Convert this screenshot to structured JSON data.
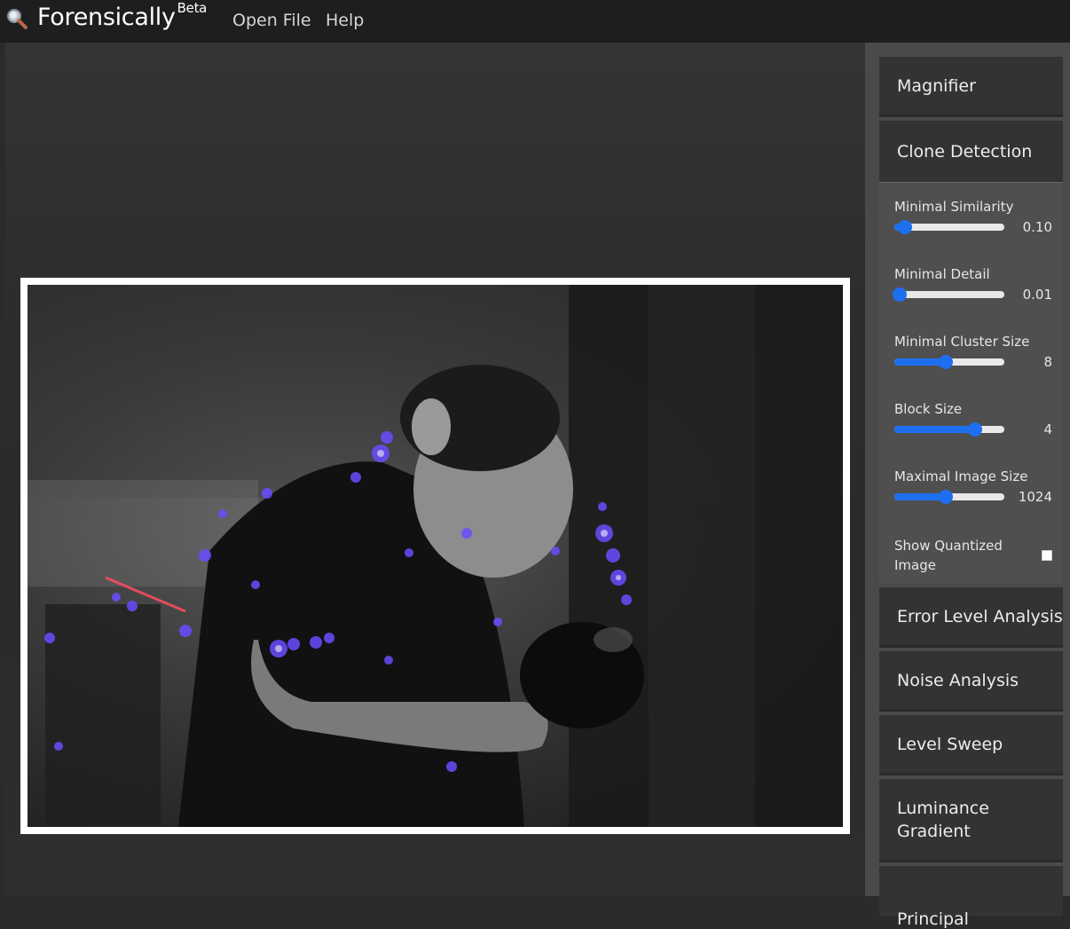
{
  "header": {
    "brand": "Forensically",
    "brand_sup": "Beta",
    "nav": {
      "open_file": "Open File",
      "help": "Help"
    }
  },
  "sidebar": {
    "panels_top": [
      {
        "id": "magnifier",
        "label": "Magnifier"
      },
      {
        "id": "clone",
        "label": "Clone Detection"
      }
    ],
    "clone_controls": [
      {
        "label": "Minimal Similarity",
        "value": "0.10",
        "fraction": 0.1
      },
      {
        "label": "Minimal Detail",
        "value": "0.01",
        "fraction": 0.05
      },
      {
        "label": "Minimal Cluster Size",
        "value": "8",
        "fraction": 0.47
      },
      {
        "label": "Block Size",
        "value": "4",
        "fraction": 0.73
      },
      {
        "label": "Maximal Image Size",
        "value": "1024",
        "fraction": 0.47
      }
    ],
    "show_quantized": {
      "label": "Show Quantized Image",
      "checked": false
    },
    "panels_bottom": [
      {
        "id": "ela",
        "label": "Error Level Analysis"
      },
      {
        "id": "noise",
        "label": "Noise Analysis"
      },
      {
        "id": "sweep",
        "label": "Level Sweep"
      },
      {
        "id": "luminance",
        "label": "Luminance Gradient"
      },
      {
        "id": "pca",
        "label": "Principal"
      }
    ]
  },
  "colors": {
    "accent": "#1e6ff0",
    "header_bg": "#1e1e1e",
    "panel_bg": "#333333"
  },
  "icons": {
    "logo": "magnifier-icon"
  }
}
